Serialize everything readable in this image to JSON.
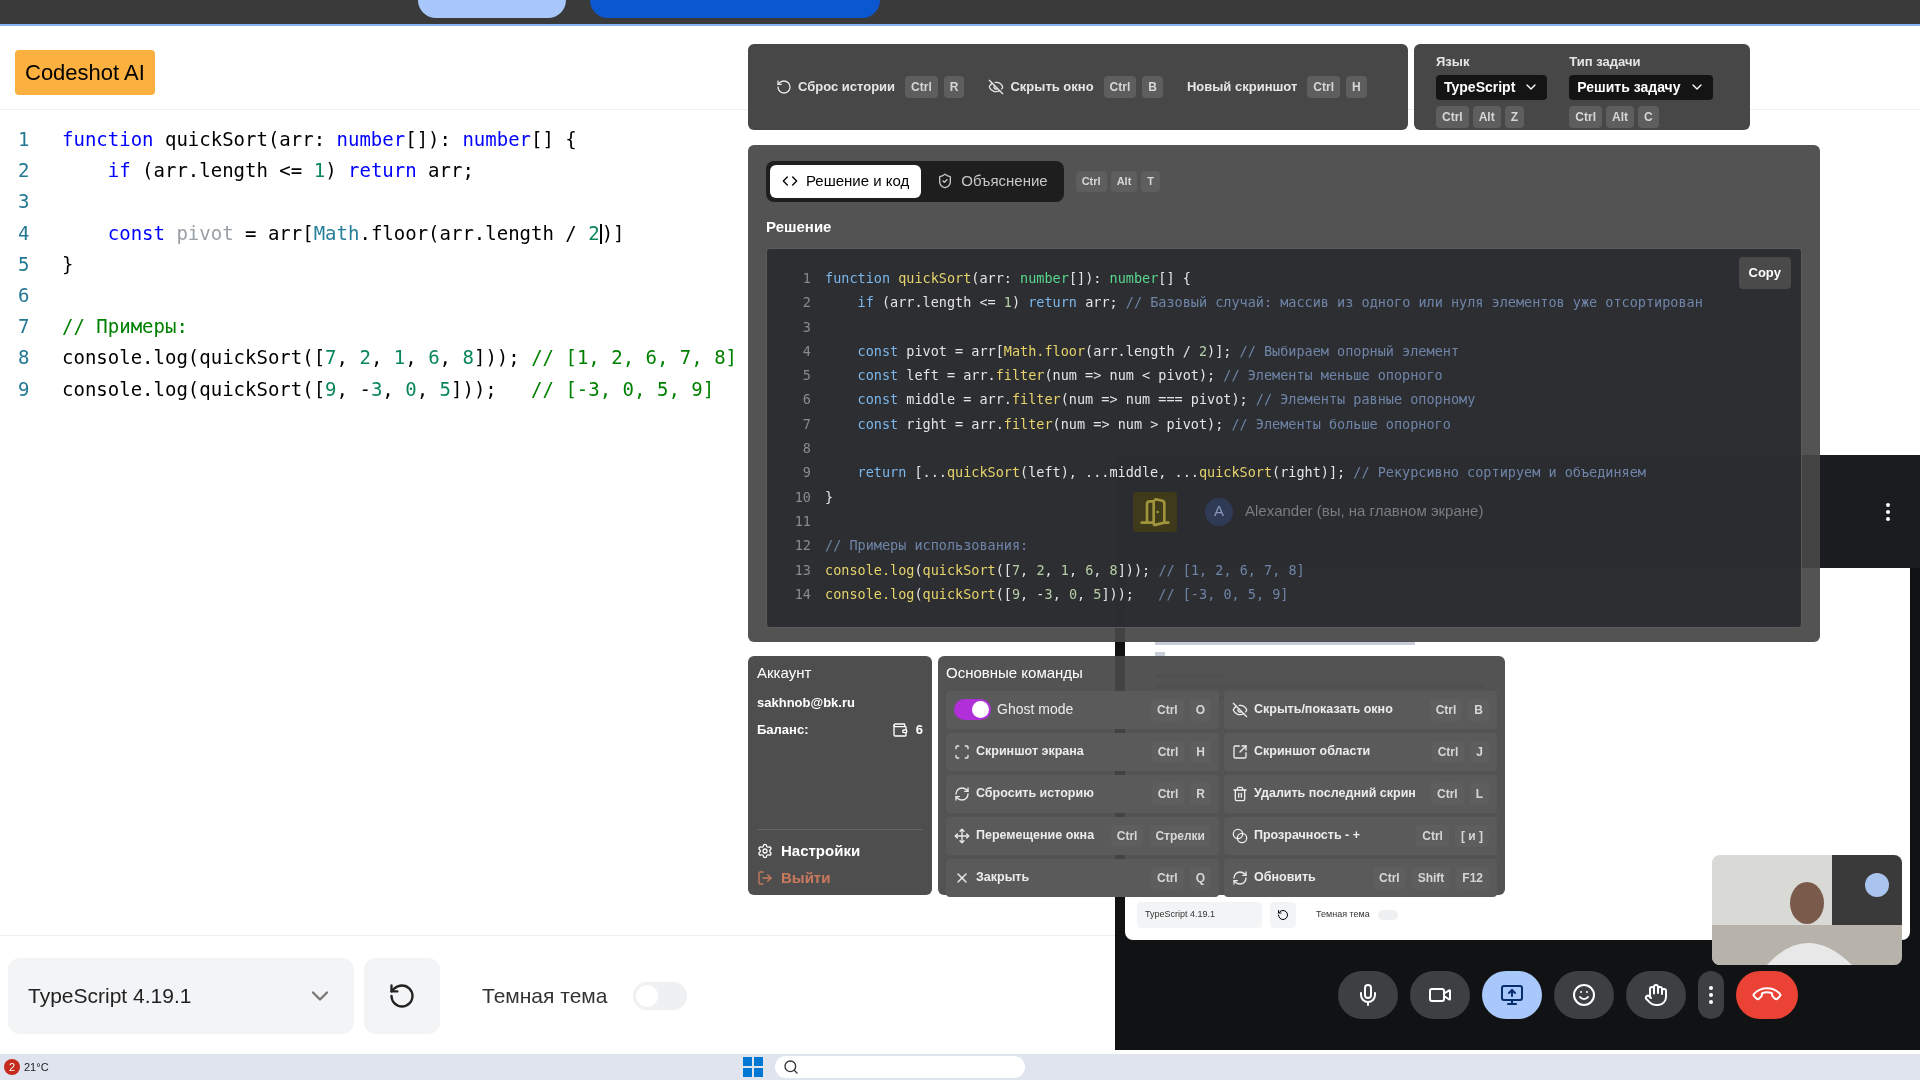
{
  "app_badge": "Codeshot AI",
  "editor": {
    "lines": [
      {
        "number": "1",
        "tokens": [
          {
            "kind": "kw",
            "text": "function"
          },
          {
            "kind": "plain",
            "text": " quickSort(arr: "
          },
          {
            "kind": "kw",
            "text": "number"
          },
          {
            "kind": "plain",
            "text": "[]): "
          },
          {
            "kind": "kw",
            "text": "number"
          },
          {
            "kind": "plain",
            "text": "[] {"
          }
        ]
      },
      {
        "number": "2",
        "tokens": [
          {
            "kind": "kw",
            "text": "    if"
          },
          {
            "kind": "plain",
            "text": " (arr.length <= "
          },
          {
            "kind": "num",
            "text": "1"
          },
          {
            "kind": "plain",
            "text": ") "
          },
          {
            "kind": "kw",
            "text": "return"
          },
          {
            "kind": "plain",
            "text": " arr;"
          }
        ]
      },
      {
        "number": "3"
      },
      {
        "number": "4",
        "tokens": [
          {
            "kind": "kw",
            "text": "    const"
          },
          {
            "kind": "dim",
            "text": " pivot"
          },
          {
            "kind": "plain",
            "text": " = arr["
          },
          {
            "kind": "cls",
            "text": "Math"
          },
          {
            "kind": "plain",
            "text": ".floor(arr.length / "
          },
          {
            "kind": "num",
            "text": "2"
          },
          {
            "kind": "caret"
          },
          {
            "kind": "plain",
            "text": ")]"
          }
        ]
      },
      {
        "number": "5",
        "tokens": [
          {
            "kind": "plain",
            "text": "}"
          }
        ]
      },
      {
        "number": "6"
      },
      {
        "number": "7",
        "tokens": [
          {
            "kind": "comment",
            "text": "// Примеры:"
          }
        ]
      },
      {
        "number": "8",
        "tokens": [
          {
            "kind": "plain",
            "text": "console.log(quickSort(["
          },
          {
            "kind": "num",
            "text": "7"
          },
          {
            "kind": "plain",
            "text": ", "
          },
          {
            "kind": "num",
            "text": "2"
          },
          {
            "kind": "plain",
            "text": ", "
          },
          {
            "kind": "num",
            "text": "1"
          },
          {
            "kind": "plain",
            "text": ", "
          },
          {
            "kind": "num",
            "text": "6"
          },
          {
            "kind": "plain",
            "text": ", "
          },
          {
            "kind": "num",
            "text": "8"
          },
          {
            "kind": "plain",
            "text": "])); "
          },
          {
            "kind": "comment",
            "text": "// [1, 2, 6, 7, 8]"
          }
        ]
      },
      {
        "number": "9",
        "tokens": [
          {
            "kind": "plain",
            "text": "console.log(quickSort(["
          },
          {
            "kind": "num",
            "text": "9"
          },
          {
            "kind": "plain",
            "text": ", -"
          },
          {
            "kind": "num",
            "text": "3"
          },
          {
            "kind": "plain",
            "text": ", "
          },
          {
            "kind": "num",
            "text": "0"
          },
          {
            "kind": "plain",
            "text": ", "
          },
          {
            "kind": "num",
            "text": "5"
          },
          {
            "kind": "plain",
            "text": "]));   "
          },
          {
            "kind": "comment",
            "text": "// [-3, 0, 5, 9]"
          }
        ]
      }
    ]
  },
  "bottom_bar": {
    "version_select": "TypeScript 4.19.1",
    "dark_theme": {
      "label": "Темная тема",
      "on": false
    }
  },
  "toolbar": {
    "actions": [
      {
        "label": "Сброс истории",
        "keys": [
          "Ctrl",
          "R"
        ]
      },
      {
        "label": "Скрыть окно",
        "keys": [
          "Ctrl",
          "B"
        ]
      },
      {
        "label": "Новый скриншот",
        "keys": [
          "Ctrl",
          "H"
        ]
      }
    ]
  },
  "settings": [
    {
      "label": "Язык",
      "value": "TypeScript",
      "keys": [
        "Ctrl",
        "Alt",
        "Z"
      ]
    },
    {
      "label": "Тип задачи",
      "value": "Решить задачу",
      "keys": [
        "Ctrl",
        "Alt",
        "C"
      ]
    }
  ],
  "solution_panel": {
    "tabs": [
      {
        "label": "Решение и код",
        "selected": true
      },
      {
        "label": "Объяснение",
        "selected": false
      }
    ],
    "tab_keys": [
      "Ctrl",
      "Alt",
      "T"
    ],
    "heading": "Решение",
    "copy_button": "Copy",
    "lines": [
      {
        "number": "1",
        "tokens": [
          {
            "kind": "kw",
            "text": "function "
          },
          {
            "kind": "fn",
            "text": "quickSort"
          },
          {
            "kind": "plain",
            "text": "(arr: "
          },
          {
            "kind": "type",
            "text": "number"
          },
          {
            "kind": "plain",
            "text": "[]): "
          },
          {
            "kind": "type",
            "text": "number"
          },
          {
            "kind": "plain",
            "text": "[] {"
          }
        ]
      },
      {
        "number": "2",
        "tokens": [
          {
            "kind": "kw",
            "text": "    if"
          },
          {
            "kind": "plain",
            "text": " (arr.length <= "
          },
          {
            "kind": "num",
            "text": "1"
          },
          {
            "kind": "plain",
            "text": ") "
          },
          {
            "kind": "kw",
            "text": "return"
          },
          {
            "kind": "plain",
            "text": " arr; "
          },
          {
            "kind": "comment",
            "text": "// Базовый случай: массив из одного или нуля элементов уже отсортирован"
          }
        ]
      },
      {
        "number": "3"
      },
      {
        "number": "4",
        "tokens": [
          {
            "kind": "kw",
            "text": "    const"
          },
          {
            "kind": "plain",
            "text": " pivot = arr["
          },
          {
            "kind": "fn",
            "text": "Math.floor"
          },
          {
            "kind": "plain",
            "text": "(arr.length / "
          },
          {
            "kind": "num",
            "text": "2"
          },
          {
            "kind": "plain",
            "text": ")]; "
          },
          {
            "kind": "comment",
            "text": "// Выбираем опорный элемент"
          }
        ]
      },
      {
        "number": "5",
        "tokens": [
          {
            "kind": "kw",
            "text": "    const"
          },
          {
            "kind": "plain",
            "text": " left = arr."
          },
          {
            "kind": "fn",
            "text": "filter"
          },
          {
            "kind": "plain",
            "text": "(num => num < pivot); "
          },
          {
            "kind": "comment",
            "text": "// Элементы меньше опорного"
          }
        ]
      },
      {
        "number": "6",
        "tokens": [
          {
            "kind": "kw",
            "text": "    const"
          },
          {
            "kind": "plain",
            "text": " middle = arr."
          },
          {
            "kind": "fn",
            "text": "filter"
          },
          {
            "kind": "plain",
            "text": "(num => num === pivot); "
          },
          {
            "kind": "comment",
            "text": "// Элементы равные опорному"
          }
        ]
      },
      {
        "number": "7",
        "tokens": [
          {
            "kind": "kw",
            "text": "    const"
          },
          {
            "kind": "plain",
            "text": " right = arr."
          },
          {
            "kind": "fn",
            "text": "filter"
          },
          {
            "kind": "plain",
            "text": "(num => num > pivot); "
          },
          {
            "kind": "comment",
            "text": "// Элементы больше опорного"
          }
        ]
      },
      {
        "number": "8"
      },
      {
        "number": "9",
        "tokens": [
          {
            "kind": "kw",
            "text": "    return"
          },
          {
            "kind": "plain",
            "text": " [..."
          },
          {
            "kind": "fn",
            "text": "quickSort"
          },
          {
            "kind": "plain",
            "text": "(left), ...middle, ..."
          },
          {
            "kind": "fn",
            "text": "quickSort"
          },
          {
            "kind": "plain",
            "text": "(right)]; "
          },
          {
            "kind": "comment",
            "text": "// Рекурсивно сортируем и объединяем"
          }
        ]
      },
      {
        "number": "10",
        "tokens": [
          {
            "kind": "plain",
            "text": "}"
          }
        ]
      },
      {
        "number": "11"
      },
      {
        "number": "12",
        "tokens": [
          {
            "kind": "comment",
            "text": "// Примеры использования:"
          }
        ]
      },
      {
        "number": "13",
        "tokens": [
          {
            "kind": "fn",
            "text": "console.log"
          },
          {
            "kind": "plain",
            "text": "("
          },
          {
            "kind": "fn",
            "text": "quickSort"
          },
          {
            "kind": "plain",
            "text": "(["
          },
          {
            "kind": "num",
            "text": "7"
          },
          {
            "kind": "plain",
            "text": ", "
          },
          {
            "kind": "num",
            "text": "2"
          },
          {
            "kind": "plain",
            "text": ", "
          },
          {
            "kind": "num",
            "text": "1"
          },
          {
            "kind": "plain",
            "text": ", "
          },
          {
            "kind": "num",
            "text": "6"
          },
          {
            "kind": "plain",
            "text": ", "
          },
          {
            "kind": "num",
            "text": "8"
          },
          {
            "kind": "plain",
            "text": "])); "
          },
          {
            "kind": "comment",
            "text": "// [1, 2, 6, 7, 8]"
          }
        ]
      },
      {
        "number": "14",
        "tokens": [
          {
            "kind": "fn",
            "text": "console.log"
          },
          {
            "kind": "plain",
            "text": "("
          },
          {
            "kind": "fn",
            "text": "quickSort"
          },
          {
            "kind": "plain",
            "text": "(["
          },
          {
            "kind": "num",
            "text": "9"
          },
          {
            "kind": "plain",
            "text": ", -"
          },
          {
            "kind": "num",
            "text": "3"
          },
          {
            "kind": "plain",
            "text": ", "
          },
          {
            "kind": "num",
            "text": "0"
          },
          {
            "kind": "plain",
            "text": ", "
          },
          {
            "kind": "num",
            "text": "5"
          },
          {
            "kind": "plain",
            "text": "]));   "
          },
          {
            "kind": "comment",
            "text": "// [-3, 0, 5, 9]"
          }
        ]
      }
    ]
  },
  "account": {
    "title": "Аккаунт",
    "email": "sakhnob@bk.ru",
    "balance_label": "Баланс:",
    "balance": "6",
    "settings": "Настройки",
    "logout": "Выйти"
  },
  "commands": {
    "title": "Основные команды",
    "items": [
      {
        "kind": "toggle",
        "label": "Ghost mode",
        "on": true,
        "keys": [
          "Ctrl",
          "O"
        ]
      },
      {
        "kind": "command",
        "label": "Скрыть/показать окно",
        "keys": [
          "Ctrl",
          "B"
        ]
      },
      {
        "kind": "command",
        "label": "Скриншот экрана",
        "keys": [
          "Ctrl",
          "H"
        ]
      },
      {
        "kind": "command",
        "label": "Скриншот области",
        "keys": [
          "Ctrl",
          "J"
        ]
      },
      {
        "kind": "command",
        "label": "Сбросить историю",
        "keys": [
          "Ctrl",
          "R"
        ]
      },
      {
        "kind": "command",
        "label": "Удалить последний скрин",
        "keys": [
          "Ctrl",
          "L"
        ]
      },
      {
        "kind": "command",
        "label": "Перемещение окна",
        "keys": [
          "Ctrl",
          "Стрелки"
        ]
      },
      {
        "kind": "command",
        "label": "Прозрачность - +",
        "keys": [
          "Ctrl",
          "[ и ]"
        ]
      },
      {
        "kind": "command",
        "label": "Закрыть",
        "keys": [
          "Ctrl",
          "Q"
        ]
      },
      {
        "kind": "command",
        "label": "Обновить",
        "keys": [
          "Ctrl",
          "Shift",
          "F12"
        ]
      }
    ]
  },
  "call_window": {
    "participant": {
      "avatar": "A",
      "name": "Alexander (вы, на главном экране)"
    },
    "shared_screen": {
      "version_select": "TypeScript 4.19.1",
      "dark_theme": "Темная тема"
    },
    "controls": [
      {
        "kind": "mic"
      },
      {
        "kind": "camera"
      },
      {
        "kind": "present",
        "selected": true
      },
      {
        "kind": "emoji"
      },
      {
        "kind": "hand"
      },
      {
        "kind": "more"
      },
      {
        "kind": "hangup"
      }
    ]
  },
  "taskbar": {
    "badge": "2",
    "weather": "21°C"
  }
}
